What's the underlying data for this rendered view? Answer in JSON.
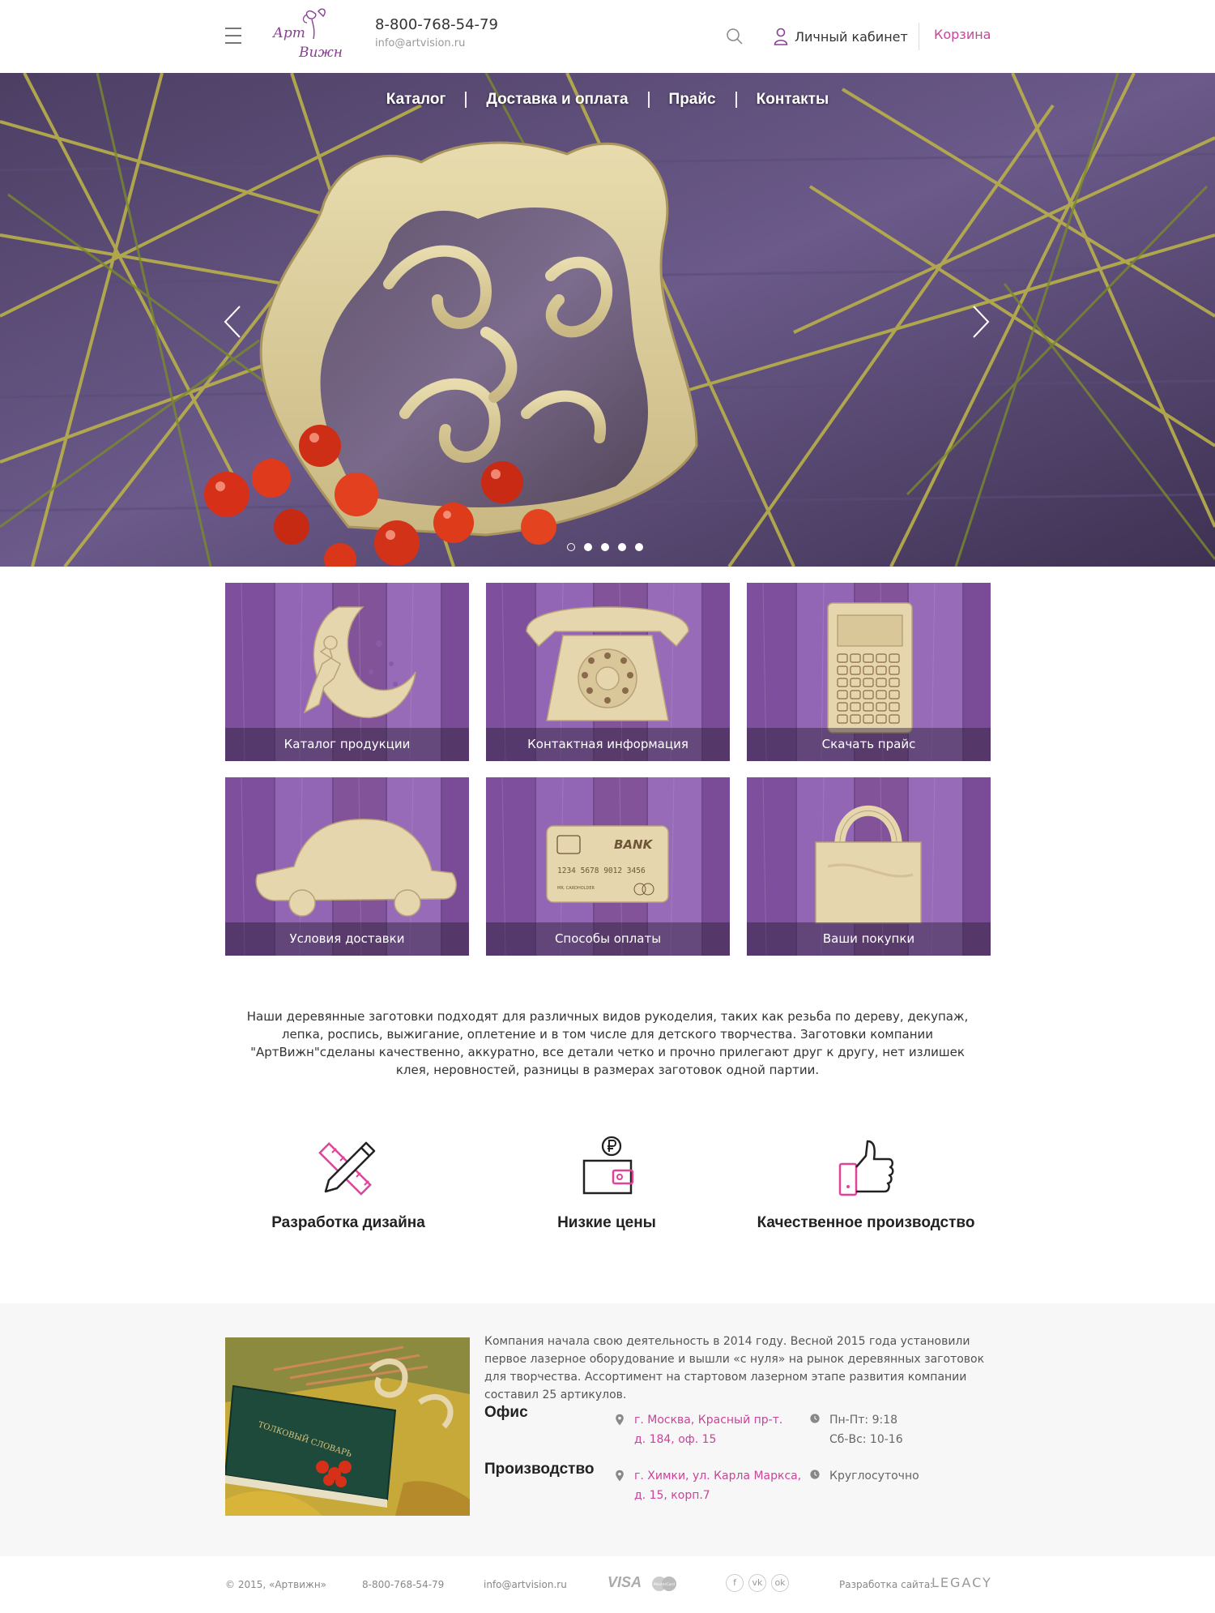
{
  "header": {
    "logo_line1": "Арт",
    "logo_line2": "Вижн",
    "phone": "8-800-768-54-79",
    "email": "info@artvision.ru",
    "account_label": "Личный кабинет",
    "cart_label": "Корзина"
  },
  "nav": {
    "items": [
      "Каталог",
      "Доставка и оплата",
      "Прайс",
      "Контакты"
    ]
  },
  "slider": {
    "total": 5,
    "active_index": 0
  },
  "tiles": [
    {
      "label": "Каталог продукции",
      "icon": "fairy-moon-icon"
    },
    {
      "label": "Контактная информация",
      "icon": "telephone-icon"
    },
    {
      "label": "Скачать прайс",
      "icon": "calculator-icon"
    },
    {
      "label": "Условия доставки",
      "icon": "car-icon"
    },
    {
      "label": "Способы оплаты",
      "icon": "bank-card-icon"
    },
    {
      "label": "Ваши покупки",
      "icon": "shopping-bag-icon"
    }
  ],
  "card_text": {
    "bank": "BANK",
    "number": "1234 5678 9012 3456",
    "holder": "MR. CARDHOLDER"
  },
  "about": "Наши деревянные заготовки подходят для различных видов рукоделия, таких как резьба по дереву, декупаж, лепка, роспись, выжигание, оплетение и в том числе для детского творчества. Заготовки компании \"АртВижн\"сделаны качественно, аккуратно, все детали четко и прочно прилегают друг к другу, нет излишек клея, неровностей, разницы в размерах заготовок одной партии.",
  "features": [
    {
      "label": "Разработка дизайна",
      "icon": "pencil-ruler-icon"
    },
    {
      "label": "Низкие цены",
      "icon": "wallet-ruble-icon"
    },
    {
      "label": "Качественное производство",
      "icon": "thumbs-up-icon"
    }
  ],
  "company": {
    "text": "Компания начала свою деятельность в 2014 году. Весной 2015 года установили первое лазерное оборудование и вышли «с нуля» на рынок деревянных заготовок для творчества. Ассортимент на стартовом лазерном этапе развития компании составил 25 артикулов.",
    "office_label": "Офис",
    "office_addr1": "г. Москва, Красный пр-т.",
    "office_addr2": "д. 184, оф. 15",
    "office_hours1": "Пн-Пт: 9:18",
    "office_hours2": "Сб-Вс: 10-16",
    "prod_label": "Производство",
    "prod_addr1": "г. Химки, ул. Карла Маркса,",
    "prod_addr2": "д. 15, корп.7",
    "prod_hours": "Круглосуточно"
  },
  "footer": {
    "copyright": "© 2015, «Артвижн»",
    "phone": "8-800-768-54-79",
    "email": "info@artvision.ru",
    "visa": "VISA",
    "mastercard": "MasterCard",
    "social": [
      "f",
      "vk",
      "ok"
    ],
    "dev_label": "Разработка сайта:",
    "dev_name": "LEGACY"
  },
  "colors": {
    "accent": "#c9449a",
    "violet": "#8a5aa8",
    "footer_bg": "#f7f7f7"
  }
}
